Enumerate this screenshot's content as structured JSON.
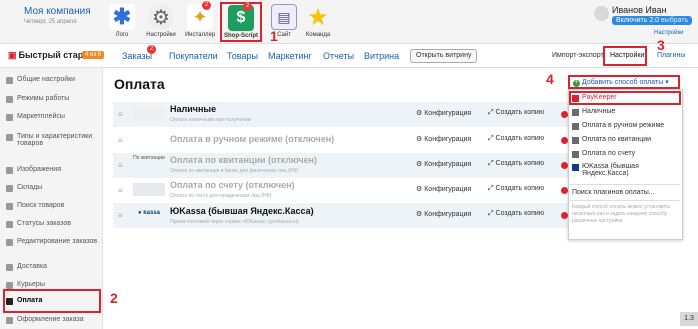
{
  "header": {
    "company": "Моя компания",
    "date": "Четверг, 25 апреля",
    "apps": [
      {
        "label": "Лого",
        "icon": "asterisk-icon",
        "badge": ""
      },
      {
        "label": "Настройки",
        "icon": "gear-icon",
        "badge": ""
      },
      {
        "label": "Инсталлер",
        "icon": "wand-icon",
        "badge": "2"
      },
      {
        "label": "Shop-Script",
        "icon": "shop-script-icon",
        "badge": "2"
      },
      {
        "label": "Сайт",
        "icon": "site-icon",
        "badge": ""
      },
      {
        "label": "Команда",
        "icon": "star-icon",
        "badge": ""
      }
    ],
    "user_name": "Иванов Иван",
    "plan_label": "Включить 2.0",
    "plan_link": "выбрать",
    "settings_link": "Настройки"
  },
  "annotations": {
    "n1": "1",
    "n2": "2",
    "n3": "3",
    "n4": "4"
  },
  "nav": {
    "quick_start": "Быстрый старт",
    "quick_start_badge": "4 из 6",
    "orders": "Заказы",
    "orders_badge": "2",
    "customers": "Покупатели",
    "products": "Товары",
    "marketing": "Маркетинг",
    "reports": "Отчеты",
    "storefront": "Витрина",
    "open_storefront": "Открыть витрину",
    "import_export": "Импорт-экспорт",
    "settings": "Настройки",
    "plugins": "Плагины"
  },
  "sidebar": {
    "items": [
      {
        "label": "Общие настройки"
      },
      {
        "label": "Режимы работы"
      },
      {
        "label": "Маркетплейсы"
      },
      {
        "label": "Типы и характеристики товаров"
      },
      {
        "label": "Изображения"
      },
      {
        "label": "Склады"
      },
      {
        "label": "Поиск товаров"
      },
      {
        "label": "Статусы заказов"
      },
      {
        "label": "Редактирование заказов"
      },
      {
        "label": "Доставка"
      },
      {
        "label": "Курьеры"
      },
      {
        "label": "Оплата"
      },
      {
        "label": "Оформление заказа"
      }
    ]
  },
  "main": {
    "title": "Оплата",
    "config_label": "Конфигурация",
    "copy_label": "Создать копию",
    "payments": [
      {
        "name": "Наличные",
        "desc": "Оплата наличными при получении",
        "logo": "",
        "disabled": false
      },
      {
        "name": "Оплата в ручном режиме (отключен)",
        "desc": "",
        "logo": "",
        "disabled": true
      },
      {
        "name": "Оплата по квитанции (отключен)",
        "desc": "Оплата по квитанции в банке для физических лиц (РФ)",
        "logo": "По квитанции",
        "disabled": true
      },
      {
        "name": "Оплата по счету (отключен)",
        "desc": "Оплата по счету для юридических лиц (РФ)",
        "logo": "",
        "disabled": true
      },
      {
        "name": "ЮKassa (бывшая Яндекс.Касса)",
        "desc": "Прием платежей через сервис «ЮKassa» (yookassa.ru).",
        "logo": "kassa",
        "disabled": false
      }
    ]
  },
  "dropdown": {
    "button": "Добавить способ оплаты",
    "items": [
      {
        "label": "PayKeeper",
        "color": "#d9232e"
      },
      {
        "label": "Наличные",
        "color": ""
      },
      {
        "label": "Оплата в ручном режиме",
        "color": ""
      },
      {
        "label": "Оплата по квитанции",
        "color": ""
      },
      {
        "label": "Оплата по счету",
        "color": ""
      },
      {
        "label": "ЮKassa (бывшая Яндекс.Касса)",
        "color": ""
      }
    ],
    "search_plugins": "Поиск плагинов оплаты...",
    "note": "Каждый способ оплаты можно установить несколько раз и задать каждому способу различные настройки."
  },
  "page_badge": "1.3",
  "colors": {
    "accent_red": "#d9232e",
    "link_blue": "#1a5fb4",
    "row_alt": "#eef3f8"
  }
}
